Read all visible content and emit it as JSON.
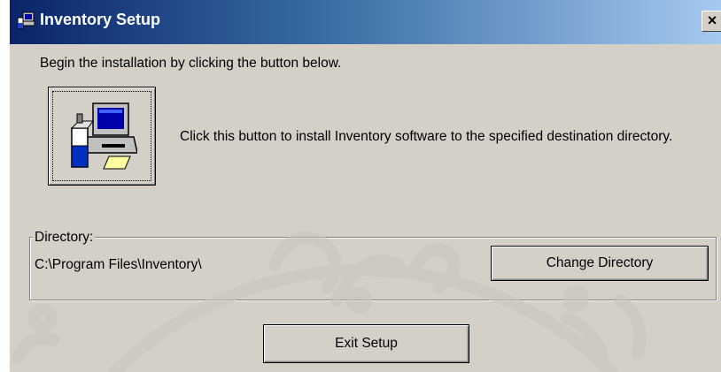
{
  "window": {
    "title": "Inventory Setup",
    "close_label": "×"
  },
  "intro_text": "Begin the installation by clicking the button below.",
  "install": {
    "description": "Click this button to install Inventory software to the specified destination directory."
  },
  "directory": {
    "group_label": "Directory:",
    "path": "C:\\Program Files\\Inventory\\",
    "change_button": "Change Directory"
  },
  "exit_button": "Exit Setup",
  "icons": [
    "setup-icon",
    "close-icon",
    "computer-install-icon"
  ]
}
